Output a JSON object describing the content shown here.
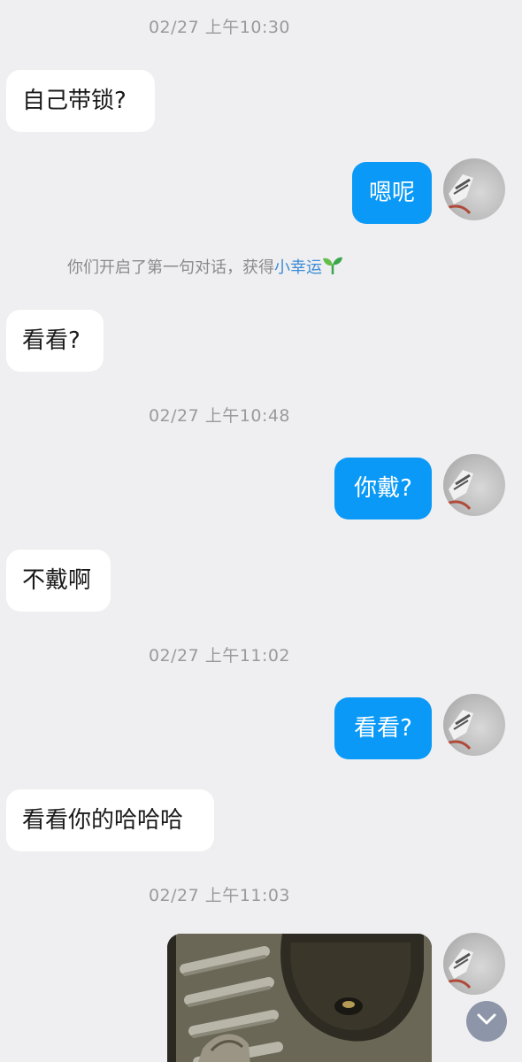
{
  "timestamps": [
    "02/27 上午10:30",
    "02/27 上午10:48",
    "02/27 上午11:02",
    "02/27 上午11:03"
  ],
  "system_message": {
    "text": "你们开启了第一句对话，获得",
    "highlight": "小幸运",
    "icon": "sprout-icon"
  },
  "messages": [
    {
      "side": "incoming",
      "text": "自己带锁?"
    },
    {
      "side": "outgoing",
      "text": "嗯呢"
    },
    {
      "side": "incoming",
      "text": "看看?"
    },
    {
      "side": "outgoing",
      "text": "你戴?"
    },
    {
      "side": "incoming",
      "text": "不戴啊"
    },
    {
      "side": "outgoing",
      "text": "看看?"
    },
    {
      "side": "incoming",
      "text": "看看你的哈哈哈"
    },
    {
      "side": "outgoing",
      "type": "image",
      "description": "photo"
    }
  ],
  "colors": {
    "background": "#efeff1",
    "outgoing_bubble": "#0a99f7",
    "incoming_bubble": "#ffffff",
    "timestamp_text": "#9a9a9a",
    "highlight": "#3d8bd6"
  },
  "scroll_button": {
    "icon": "chevron-down-icon"
  }
}
